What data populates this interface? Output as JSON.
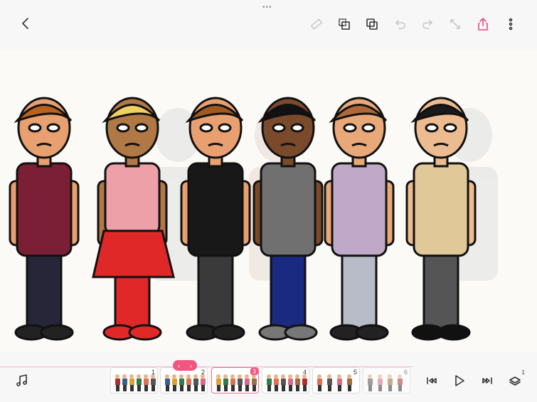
{
  "toolbar": {
    "back": "back-icon",
    "items": [
      "ruler-icon",
      "lasso-select-icon",
      "duplicate-layer-icon",
      "undo-icon",
      "redo-icon",
      "resize-icon",
      "share-icon",
      "more-icon"
    ]
  },
  "timeline": {
    "frames": [
      {
        "number": "1"
      },
      {
        "number": "2"
      },
      {
        "number": "3"
      },
      {
        "number": "4"
      },
      {
        "number": "5"
      },
      {
        "number": "6"
      }
    ],
    "selected_frame": "3",
    "nav_prev": "‹",
    "nav_next": "›",
    "layers_count": "1"
  },
  "colors": {
    "accent": "#f0567f",
    "background": "#f7f7f7",
    "canvas": "#fbfaf7"
  }
}
